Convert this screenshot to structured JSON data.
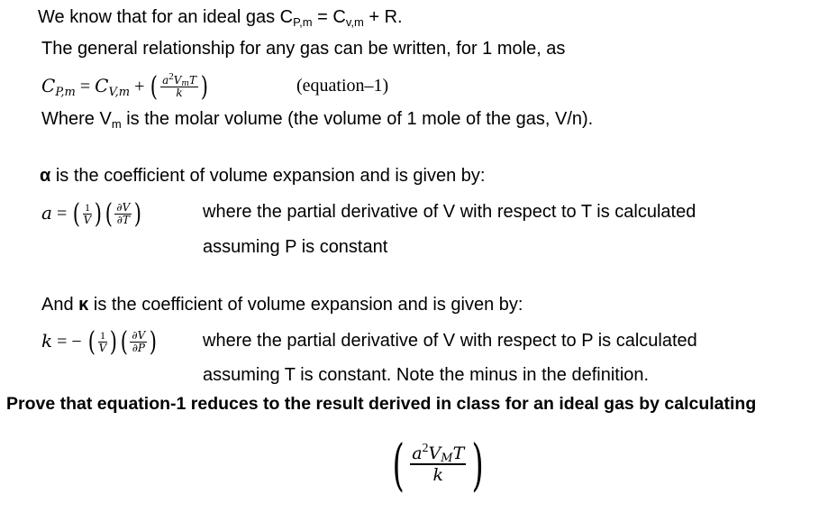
{
  "line1": {
    "prefix": "We know that for an ideal gas C",
    "sub_p": "P,m",
    "eq": " = C",
    "sub_v": "v,m",
    "suffix": " + R."
  },
  "line2": "The general relationship for any gas can be written, for 1 mole, as",
  "equation1": {
    "lhs": "C",
    "lhs_sub": "P,m",
    "eq": " = ",
    "rhs": "C",
    "rhs_sub": "V,m",
    "plus": " + ",
    "num_a": "a",
    "num_exp": "2",
    "num_v": "V",
    "num_v_sub": "m",
    "num_t": "T",
    "den": "k",
    "label": "(equation–1)"
  },
  "line_vm": {
    "prefix": "Where V",
    "sub": "m",
    "suffix": " is the molar volume (the volume of 1 mole of the gas, V/n)."
  },
  "alpha_intro": {
    "symbol": "α",
    "text": " is the coefficient of volume expansion and is given by:"
  },
  "alpha_eq": {
    "lhs": "a",
    "eq": " = ",
    "f1_num": "1",
    "f1_den": "V",
    "f2_num": "∂V",
    "f2_den": "∂T",
    "desc1": "where the partial derivative of V with respect to T is calculated",
    "desc2": "assuming P is constant"
  },
  "kappa_intro": {
    "prefix": "And ",
    "symbol": "κ",
    "text": " is the coefficient of volume expansion and is given by:"
  },
  "kappa_eq": {
    "lhs": "k",
    "eq": " = ",
    "minus": "−",
    "f1_num": "1",
    "f1_den": "V",
    "f2_num": "∂V",
    "f2_den": "∂P",
    "desc1": "where the partial derivative of V with respect to P is calculated",
    "desc2": "assuming T is constant. Note the minus in the definition."
  },
  "prove": "Prove that equation-1 reduces to the result derived in class for an ideal gas by calculating",
  "final_expr": {
    "num_a": "a",
    "num_exp": "2",
    "num_v": "V",
    "num_v_sub": "M",
    "num_t": "T",
    "den": "k"
  }
}
